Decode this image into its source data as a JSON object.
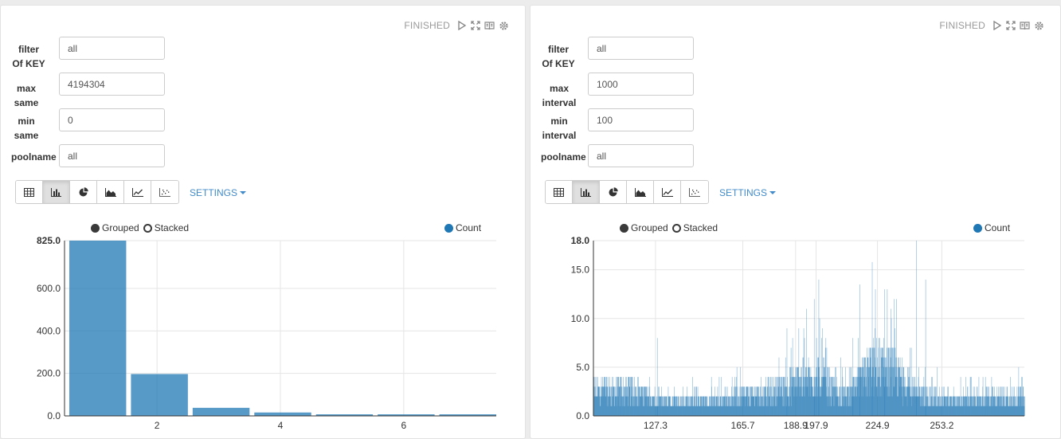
{
  "panels": [
    {
      "status": "FINISHED",
      "form": [
        {
          "label": "filter Of KEY",
          "value": "all"
        },
        {
          "label": "max same",
          "value": "4194304"
        },
        {
          "label": "min same",
          "value": "0"
        },
        {
          "label": "poolname",
          "value": "all"
        }
      ],
      "toolbar": {
        "buttons": [
          "table-icon",
          "bar-chart-icon",
          "pie-chart-icon",
          "area-chart-icon",
          "line-chart-icon",
          "scatter-chart-icon"
        ],
        "active": "bar-chart-icon",
        "settings_label": "SETTINGS"
      },
      "legend": {
        "grouped": "Grouped",
        "stacked": "Stacked",
        "series": "Count"
      }
    },
    {
      "status": "FINISHED",
      "form": [
        {
          "label": "filter Of KEY",
          "value": "all"
        },
        {
          "label": "max interval",
          "value": "1000"
        },
        {
          "label": "min interval",
          "value": "100"
        },
        {
          "label": "poolname",
          "value": "all"
        }
      ],
      "toolbar": {
        "buttons": [
          "table-icon",
          "bar-chart-icon",
          "pie-chart-icon",
          "area-chart-icon",
          "line-chart-icon",
          "scatter-chart-icon"
        ],
        "active": "bar-chart-icon",
        "settings_label": "SETTINGS"
      },
      "legend": {
        "grouped": "Grouped",
        "stacked": "Stacked",
        "series": "Count"
      }
    }
  ],
  "colors": {
    "bar": "#1f77b4",
    "grid": "#e5e5e5",
    "link": "#428bca"
  },
  "chart_data": [
    {
      "type": "bar",
      "categories": [
        1,
        2,
        3,
        4,
        5,
        6,
        7
      ],
      "series": [
        {
          "name": "Count",
          "values": [
            825,
            197,
            38,
            16,
            5,
            3,
            2
          ]
        }
      ],
      "xticks": [
        2,
        4,
        6
      ],
      "yticks": [
        0,
        200,
        400,
        600,
        825
      ],
      "ytick_labels": [
        "0.0",
        "200.0",
        "400.0",
        "600.0",
        "825.0"
      ],
      "ylim": [
        0,
        825
      ],
      "grid": true,
      "legend_position": "top-right"
    },
    {
      "type": "bar",
      "series": [
        {
          "name": "Count",
          "values": []
        }
      ],
      "xrange": [
        100,
        289.5
      ],
      "xtick_labels": [
        "127.3",
        "165.7",
        "188.9",
        "197.9",
        "224.9",
        "253.2"
      ],
      "yticks": [
        0,
        5,
        10,
        15,
        18
      ],
      "ytick_labels": [
        "0.0",
        "5.0",
        "10.0",
        "15.0",
        "18.0"
      ],
      "ylim": [
        0,
        18
      ],
      "profile": [
        [
          100,
          2.5,
          4.5
        ],
        [
          118,
          2.5,
          4.5
        ],
        [
          128,
          1.5,
          4
        ],
        [
          150,
          1.5,
          4
        ],
        [
          168,
          2,
          5
        ],
        [
          180,
          2.5,
          5.5
        ],
        [
          190,
          3.5,
          10
        ],
        [
          200,
          4,
          12
        ],
        [
          205,
          2.5,
          6
        ],
        [
          212,
          2,
          5
        ],
        [
          216,
          3,
          8
        ],
        [
          222,
          5,
          14
        ],
        [
          232,
          4.5,
          13
        ],
        [
          238,
          3,
          8
        ],
        [
          245,
          2,
          5.5
        ],
        [
          260,
          1.5,
          4.5
        ],
        [
          289.5,
          2,
          4.5
        ]
      ],
      "peaks": [
        [
          217,
          13.5
        ],
        [
          222.5,
          15.8
        ],
        [
          228,
          13
        ],
        [
          242,
          18
        ],
        [
          246,
          14
        ],
        [
          199,
          14
        ],
        [
          197,
          12
        ],
        [
          185,
          9
        ],
        [
          214,
          8
        ],
        [
          128,
          8
        ]
      ],
      "grid": true,
      "legend_position": "top-right"
    }
  ]
}
